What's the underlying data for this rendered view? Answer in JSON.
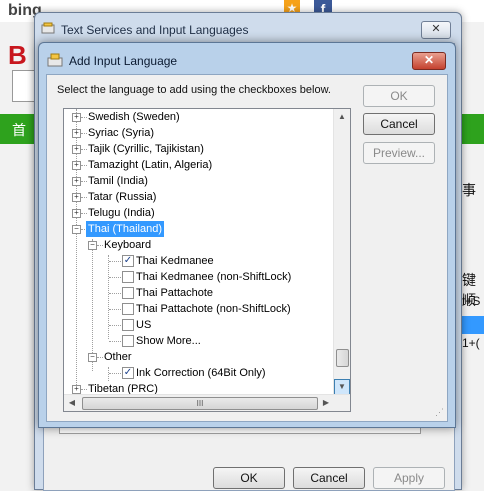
{
  "background": {
    "logo_text": "bing",
    "logo_b": "B",
    "nav_first": "首",
    "side_texts": [
      "事",
      "键顺",
      "t+S",
      "1+("
    ],
    "facebook": "f"
  },
  "outer_dialog": {
    "title": "Text Services and Input Languages",
    "close": "✕",
    "buttons": {
      "ok": "OK",
      "cancel": "Cancel",
      "apply": "Apply"
    }
  },
  "inner_dialog": {
    "title": "Add Input Language",
    "close": "✕",
    "prompt": "Select the language to add using the checkboxes below.",
    "buttons": {
      "ok": "OK",
      "cancel": "Cancel",
      "preview": "Preview..."
    },
    "tree": {
      "languages": [
        "Swedish (Sweden)",
        "Syriac (Syria)",
        "Tajik (Cyrillic, Tajikistan)",
        "Tamazight (Latin, Algeria)",
        "Tamil (India)",
        "Tatar (Russia)",
        "Telugu (India)"
      ],
      "selected_language": "Thai (Thailand)",
      "keyboard_group": "Keyboard",
      "keyboards": [
        {
          "label": "Thai Kedmanee",
          "checked": true
        },
        {
          "label": "Thai Kedmanee (non-ShiftLock)",
          "checked": false
        },
        {
          "label": "Thai Pattachote",
          "checked": false
        },
        {
          "label": "Thai Pattachote (non-ShiftLock)",
          "checked": false
        },
        {
          "label": "US",
          "checked": false
        },
        {
          "label": "Show More...",
          "checked": false
        }
      ],
      "other_group": "Other",
      "other_items": [
        {
          "label": "Ink Correction (64Bit Only)",
          "checked": true
        }
      ],
      "after": "Tibetan (PRC)"
    },
    "scrollbar": {
      "h_thumb_glyph": "III",
      "v_thumb_glyph": "="
    }
  }
}
